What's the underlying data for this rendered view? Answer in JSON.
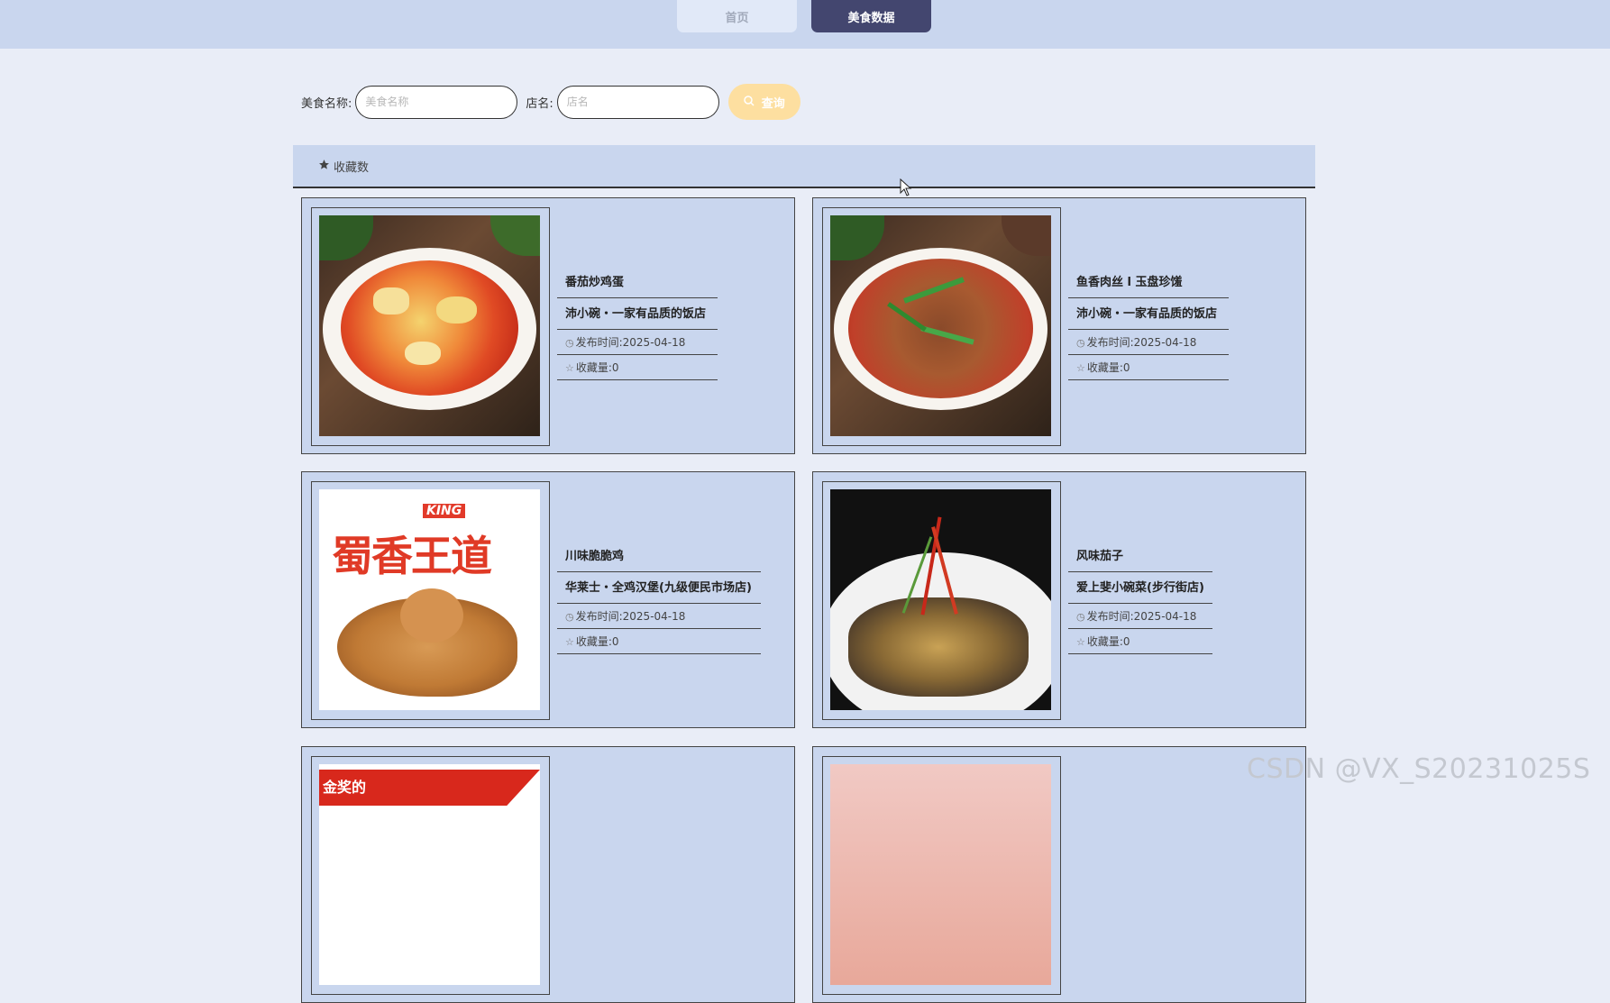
{
  "nav": {
    "tabs": [
      {
        "label": "首页",
        "active": false
      },
      {
        "label": "美食数据",
        "active": true
      }
    ]
  },
  "search": {
    "food_label": "美食名称:",
    "food_placeholder": "美食名称",
    "shop_label": "店名:",
    "shop_placeholder": "店名",
    "button_label": "查询",
    "button_icon": "search-icon"
  },
  "sort": {
    "label": "收藏数",
    "icon": "star-icon"
  },
  "cards": [
    {
      "name": "番茄炒鸡蛋",
      "shop": "沛小碗・一家有品质的饭店",
      "publish_label": "发布时间:",
      "publish_date": "2025-04-18",
      "fav_label": "收藏量:",
      "fav_count": "0",
      "image": "tomato-egg-dish"
    },
    {
      "name": "鱼香肉丝 l 玉盘珍馐",
      "shop": "沛小碗・一家有品质的饭店",
      "publish_label": "发布时间:",
      "publish_date": "2025-04-18",
      "fav_label": "收藏量:",
      "fav_count": "0",
      "image": "shredded-pork-dish"
    },
    {
      "name": "川味脆脆鸡",
      "shop": "华莱士・全鸡汉堡(九级便民市场店)",
      "publish_label": "发布时间:",
      "publish_date": "2025-04-18",
      "fav_label": "收藏量:",
      "fav_count": "0",
      "image": "fried-chicken-poster",
      "image_text": "蜀香王道",
      "image_badge": "KING"
    },
    {
      "name": "风味茄子",
      "shop": "爱上斐小碗菜(步行街店)",
      "publish_label": "发布时间:",
      "publish_date": "2025-04-18",
      "fav_label": "收藏量:",
      "fav_count": "0",
      "image": "eggplant-dish"
    }
  ],
  "partial_cards": [
    {
      "image": "award-poster",
      "image_text": "金奖的"
    },
    {
      "image": "pink-dish"
    }
  ],
  "watermark": "CSDN @VX_S20231025S",
  "colors": {
    "background": "#e9edf7",
    "panel": "#c9d6ee",
    "active_tab": "#43466f",
    "search_button": "#fddfa0"
  }
}
